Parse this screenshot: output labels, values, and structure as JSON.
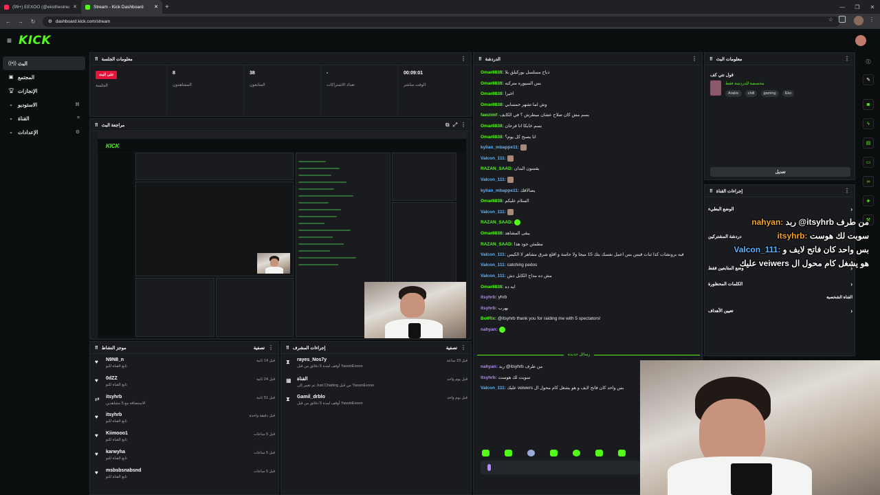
{
  "browser": {
    "tabs": [
      {
        "title": "(99+) EEXOO (@ekothestream…",
        "active": false
      },
      {
        "title": "Stream - Kick Dashboard",
        "active": true
      }
    ],
    "url": "dashboard.kick.com/stream"
  },
  "app": {
    "logo": "KICK"
  },
  "sidebar": {
    "items": [
      {
        "label": "البث",
        "icon": "broadcast-icon",
        "end": ""
      },
      {
        "label": "المجتمع",
        "icon": "community-icon",
        "end": ""
      },
      {
        "label": "الإنجازات",
        "icon": "trophy-icon",
        "end": ""
      },
      {
        "label": "الاستوديو",
        "icon": "studio-icon",
        "end": "⌘"
      },
      {
        "label": "القناة",
        "icon": "channel-icon",
        "end": "⌗"
      },
      {
        "label": "الإعدادات",
        "icon": "settings-icon",
        "end": "⚙"
      }
    ]
  },
  "session": {
    "title": "معلومات الجلسة",
    "live_label": "على البث",
    "live_sub": "الجلسة",
    "stats": [
      {
        "value": "8",
        "label": "المشاهدون"
      },
      {
        "value": "38",
        "label": "المتابعون"
      },
      {
        "value": "-",
        "label": "تعداد الاشتراكات"
      },
      {
        "value": "00:09:01",
        "label": "الوقت مباشر"
      }
    ]
  },
  "preview": {
    "title": "مراجعة البث"
  },
  "feed": {
    "title": "موجز النشاط",
    "filter": "تصفية",
    "rows": [
      {
        "name": "N9N8_n",
        "sub": "تابع القناة للتو",
        "time": "قبل 14 ثانية",
        "icon": "heart-icon"
      },
      {
        "name": "0dZZ",
        "sub": "تابع القناة للتو",
        "time": "قبل 24 ثانية",
        "icon": "heart-icon"
      },
      {
        "name": "itsyhrb",
        "sub": "الاستضافة مع 5 مشاهدين",
        "time": "قبل 51 ثانية",
        "icon": "raid-icon"
      },
      {
        "name": "itsyhrb",
        "sub": "تابع القناة للتو",
        "time": "قبل دقيقة واحدة",
        "icon": "heart-icon"
      },
      {
        "name": "Kiimooo1",
        "sub": "تابع القناة للتو",
        "time": "قبل 5 ساعات",
        "icon": "heart-icon"
      },
      {
        "name": "karwyha",
        "sub": "تابع القناة للتو",
        "time": "قبل 5 ساعات",
        "icon": "heart-icon"
      },
      {
        "name": "msbsbsnabsnd",
        "sub": "تابع القناة للتو",
        "time": "قبل 5 ساعات",
        "icon": "heart-icon"
      }
    ]
  },
  "mod_actions": {
    "title": "إجراءات المشرف",
    "filter": "تصفية",
    "rows": [
      {
        "name": "rayes_Nos7y",
        "sub": "أوقف لمدة 5 دقائق من قبل YassinExooo",
        "time": "قبل 23 ساعة",
        "icon": "hourglass-icon"
      },
      {
        "name": "القناة",
        "sub": "تم تغيير إلى Just Chatting من قبل YassinExooo",
        "time": "قبل يوم واحد",
        "icon": "channel-icon"
      },
      {
        "name": "Gamil_drblo",
        "sub": "أوقف لمدة 5 دقائق من قبل YassinExooo",
        "time": "قبل يوم واحد",
        "icon": "hourglass-icon"
      }
    ]
  },
  "chat": {
    "title": "الدردشة",
    "messages": [
      {
        "user": "Omar8838:",
        "text": "ذباح مسلسل بوركيلق بلا",
        "color": "green"
      },
      {
        "user": "Omar8838:",
        "text": "بس السيوره متركنه",
        "color": "green"
      },
      {
        "user": "Omar8838:",
        "text": "اخيرا",
        "color": "green"
      },
      {
        "user": "Omar8838:",
        "text": "وش لما تشهر حمسابي",
        "color": "green"
      },
      {
        "user": "fawzimf:",
        "text": "بسم مش كان صلاح عشان ميطرش ؟ في الكايف",
        "color": "green"
      },
      {
        "user": "Omar8838:",
        "text": "بسم خابكا انا فرحان",
        "color": "green"
      },
      {
        "user": "Omar8838:",
        "text": "انا يصبح كل يوم؟",
        "color": "green"
      },
      {
        "user": "kylian_mbappe11:",
        "text": "",
        "color": "blue"
      },
      {
        "user": "Valcon_111:",
        "text": "",
        "color": "blue"
      },
      {
        "user": "RAZAN_SAAD:",
        "text": "يقسون البدان",
        "color": "green"
      },
      {
        "user": "Valcon_111:",
        "text": "",
        "color": "blue"
      },
      {
        "user": "kylian_mbappe11:",
        "text": "يصالاقك",
        "color": "blue"
      },
      {
        "user": "Omar8838:",
        "text": "السلام عليكم",
        "color": "green"
      },
      {
        "user": "Valcon_111:",
        "text": "",
        "color": "blue"
      },
      {
        "user": "RAZAN_SAAD:",
        "text": "",
        "color": "green"
      },
      {
        "user": "Omar8838:",
        "text": "يبقى المشاهد",
        "color": "green"
      },
      {
        "user": "RAZAN_SAAD:",
        "text": "مطمئن جود هذا",
        "color": "green"
      },
      {
        "user": "Valcon_111:",
        "text": "فيه برونشات كذا ثبات قيس بس اعمل نفسك بتك 15 ميجا ولا حاسة و اقلع شرق مشاهر لا الكيس",
        "color": "blue"
      },
      {
        "user": "Valcon_111:",
        "text": "catching pedos",
        "color": "blue"
      },
      {
        "user": "Valcon_111:",
        "text": "مش ده مداح الكابل دش",
        "color": "blue"
      },
      {
        "user": "Omar8838:",
        "text": "ايه ده",
        "color": "green"
      },
      {
        "user": "itsyhrb:",
        "text": "yhrb",
        "color": "purple"
      },
      {
        "user": "itsyhrb:",
        "text": "يهرب",
        "color": "purple"
      },
      {
        "user": "BotRix:",
        "text": "@itsyhrb thank you for raiding me with 5 spectators!",
        "color": "green"
      },
      {
        "user": "nahyan:",
        "text": "",
        "color": "purple"
      }
    ],
    "new_messages": "رسائل جديدة",
    "new": [
      {
        "user": "nahyan:",
        "text": "ربد @itsyhrb من طرف",
        "color": "purple"
      },
      {
        "user": "itsyhrb:",
        "text": "سوبت لك هوست",
        "color": "purple"
      },
      {
        "user": "Valcon_111:",
        "text": "عليك veiwers بس واحد كان فاتح لايف و هو يشغل كام محول ال",
        "color": "blue"
      }
    ]
  },
  "stream_info": {
    "title": "معلومات البث",
    "stream_title": "قول نتي كف",
    "category": "مخصصة للدردشة فقط",
    "tags": [
      "Arabic",
      "chill",
      "gaming",
      "Eko"
    ],
    "edit": "تعديل"
  },
  "quick_actions": {
    "title": "إجراءات القناة",
    "items": [
      "الوضع البطيء",
      "دردشة المشتركين",
      "وضع المتابعين فقط",
      "الكلمات المحظورة",
      "القناة الشخصية",
      "تعيين الأهداف"
    ]
  },
  "overlay": {
    "lines": [
      {
        "user": "nahyan:",
        "text": "ربد @itsyhrb من طرف"
      },
      {
        "user": "itsyhrb:",
        "text": "سوبت لك هوست"
      },
      {
        "user": "Valcon_111:",
        "text": "بس واحد كان فاتح لايف و"
      },
      {
        "user": "",
        "text": "عليك veiwers هو يشغل كام محول ال"
      }
    ]
  },
  "colors": {
    "accent": "#53fc18",
    "live": "#e5153a",
    "bg": "#0b0e0f",
    "panel": "#191b1f"
  }
}
